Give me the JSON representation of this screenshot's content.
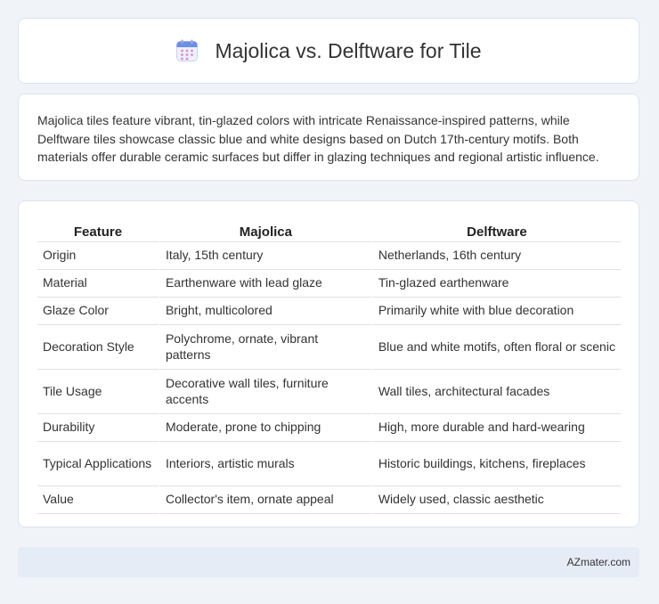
{
  "header": {
    "title": "Majolica vs. Delftware for Tile",
    "icon": "calendar-icon"
  },
  "summary": "Majolica tiles feature vibrant, tin-glazed colors with intricate Renaissance-inspired patterns, while Delftware tiles showcase classic blue and white designs based on Dutch 17th-century motifs. Both materials offer durable ceramic surfaces but differ in glazing techniques and regional artistic influence.",
  "table": {
    "headers": [
      "Feature",
      "Majolica",
      "Delftware"
    ],
    "rows": [
      [
        "Origin",
        "Italy, 15th century",
        "Netherlands, 16th century"
      ],
      [
        "Material",
        "Earthenware with lead glaze",
        "Tin-glazed earthenware"
      ],
      [
        "Glaze Color",
        "Bright, multicolored",
        "Primarily white with blue decoration"
      ],
      [
        "Decoration Style",
        "Polychrome, ornate, vibrant patterns",
        "Blue and white motifs, often floral or scenic"
      ],
      [
        "Tile Usage",
        "Decorative wall tiles, furniture accents",
        "Wall tiles, architectural facades"
      ],
      [
        "Durability",
        "Moderate, prone to chipping",
        "High, more durable and hard-wearing"
      ],
      [
        "Typical Applications",
        "Interiors, artistic murals",
        "Historic buildings, kitchens, fireplaces"
      ],
      [
        "Value",
        "Collector's item, ornate appeal",
        "Widely used, classic aesthetic"
      ]
    ]
  },
  "footer": {
    "text": "AZmater.com"
  },
  "colors": {
    "background": "#f0f3f8",
    "card": "#ffffff",
    "footer_bar": "#e6ecf6",
    "icon_accent": "#6c8ee8"
  }
}
